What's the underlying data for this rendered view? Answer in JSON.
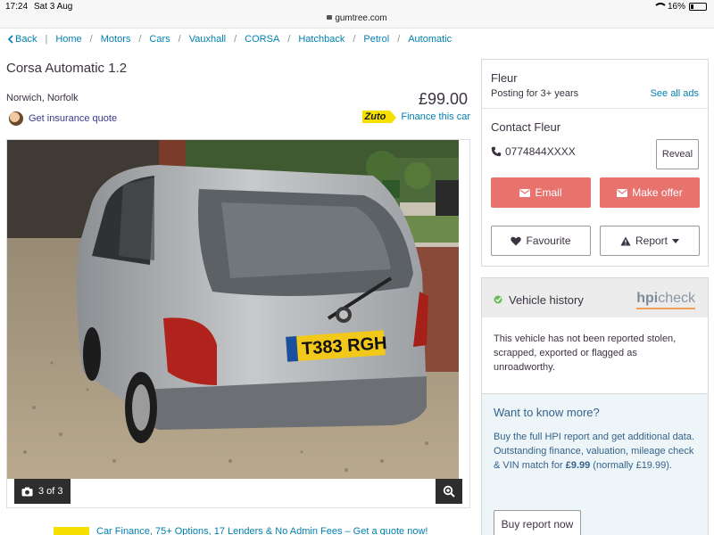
{
  "status_bar": {
    "time": "17:24",
    "date": "Sat 3 Aug",
    "url": "gumtree.com",
    "battery": "16%",
    "battery_level": 0.16
  },
  "breadcrumb": {
    "back_label": "Back",
    "items": [
      "Home",
      "Motors",
      "Cars",
      "Vauxhall",
      "CORSA",
      "Hatchback",
      "Petrol",
      "Automatic"
    ]
  },
  "listing": {
    "title": "Corsa Automatic 1.2",
    "location": "Norwich, Norfolk",
    "price": "£99.00",
    "insurance_link": "Get insurance quote",
    "finance_brand": "Zuto",
    "finance_link": "Finance this car",
    "gallery_count": "3 of 3",
    "plate": "T383 RGH"
  },
  "seller": {
    "name": "Fleur",
    "posting": "Posting for 3+ years",
    "see_all": "See all ads",
    "contact_heading": "Contact Fleur",
    "phone": "0774844XXXX",
    "reveal": "Reveal",
    "email": "Email",
    "make_offer": "Make offer",
    "favourite": "Favourite",
    "report": "Report"
  },
  "vehicle_history": {
    "title": "Vehicle history",
    "brand_hpi": "hpi",
    "brand_check": "check",
    "status_text": "This vehicle has not been reported stolen, scrapped, exported or flagged as unroadworthy.",
    "more_title": "Want to know more?",
    "more_text_1": "Buy the full HPI report and get additional data.",
    "more_text_2_pre": "Outstanding finance, valuation, mileage check & VIN match for ",
    "more_price": "£9.99",
    "more_text_2_post": " (normally £19.99).",
    "buy_button": "Buy report now"
  },
  "bottom_banner": {
    "text": "Car Finance, 75+ Options, 17 Lenders & No Admin Fees – Get a quote now!"
  },
  "colors": {
    "link": "#007fb0",
    "accent_red": "#e8726e",
    "text": "#3c3241",
    "history_blue": "#34628a"
  }
}
